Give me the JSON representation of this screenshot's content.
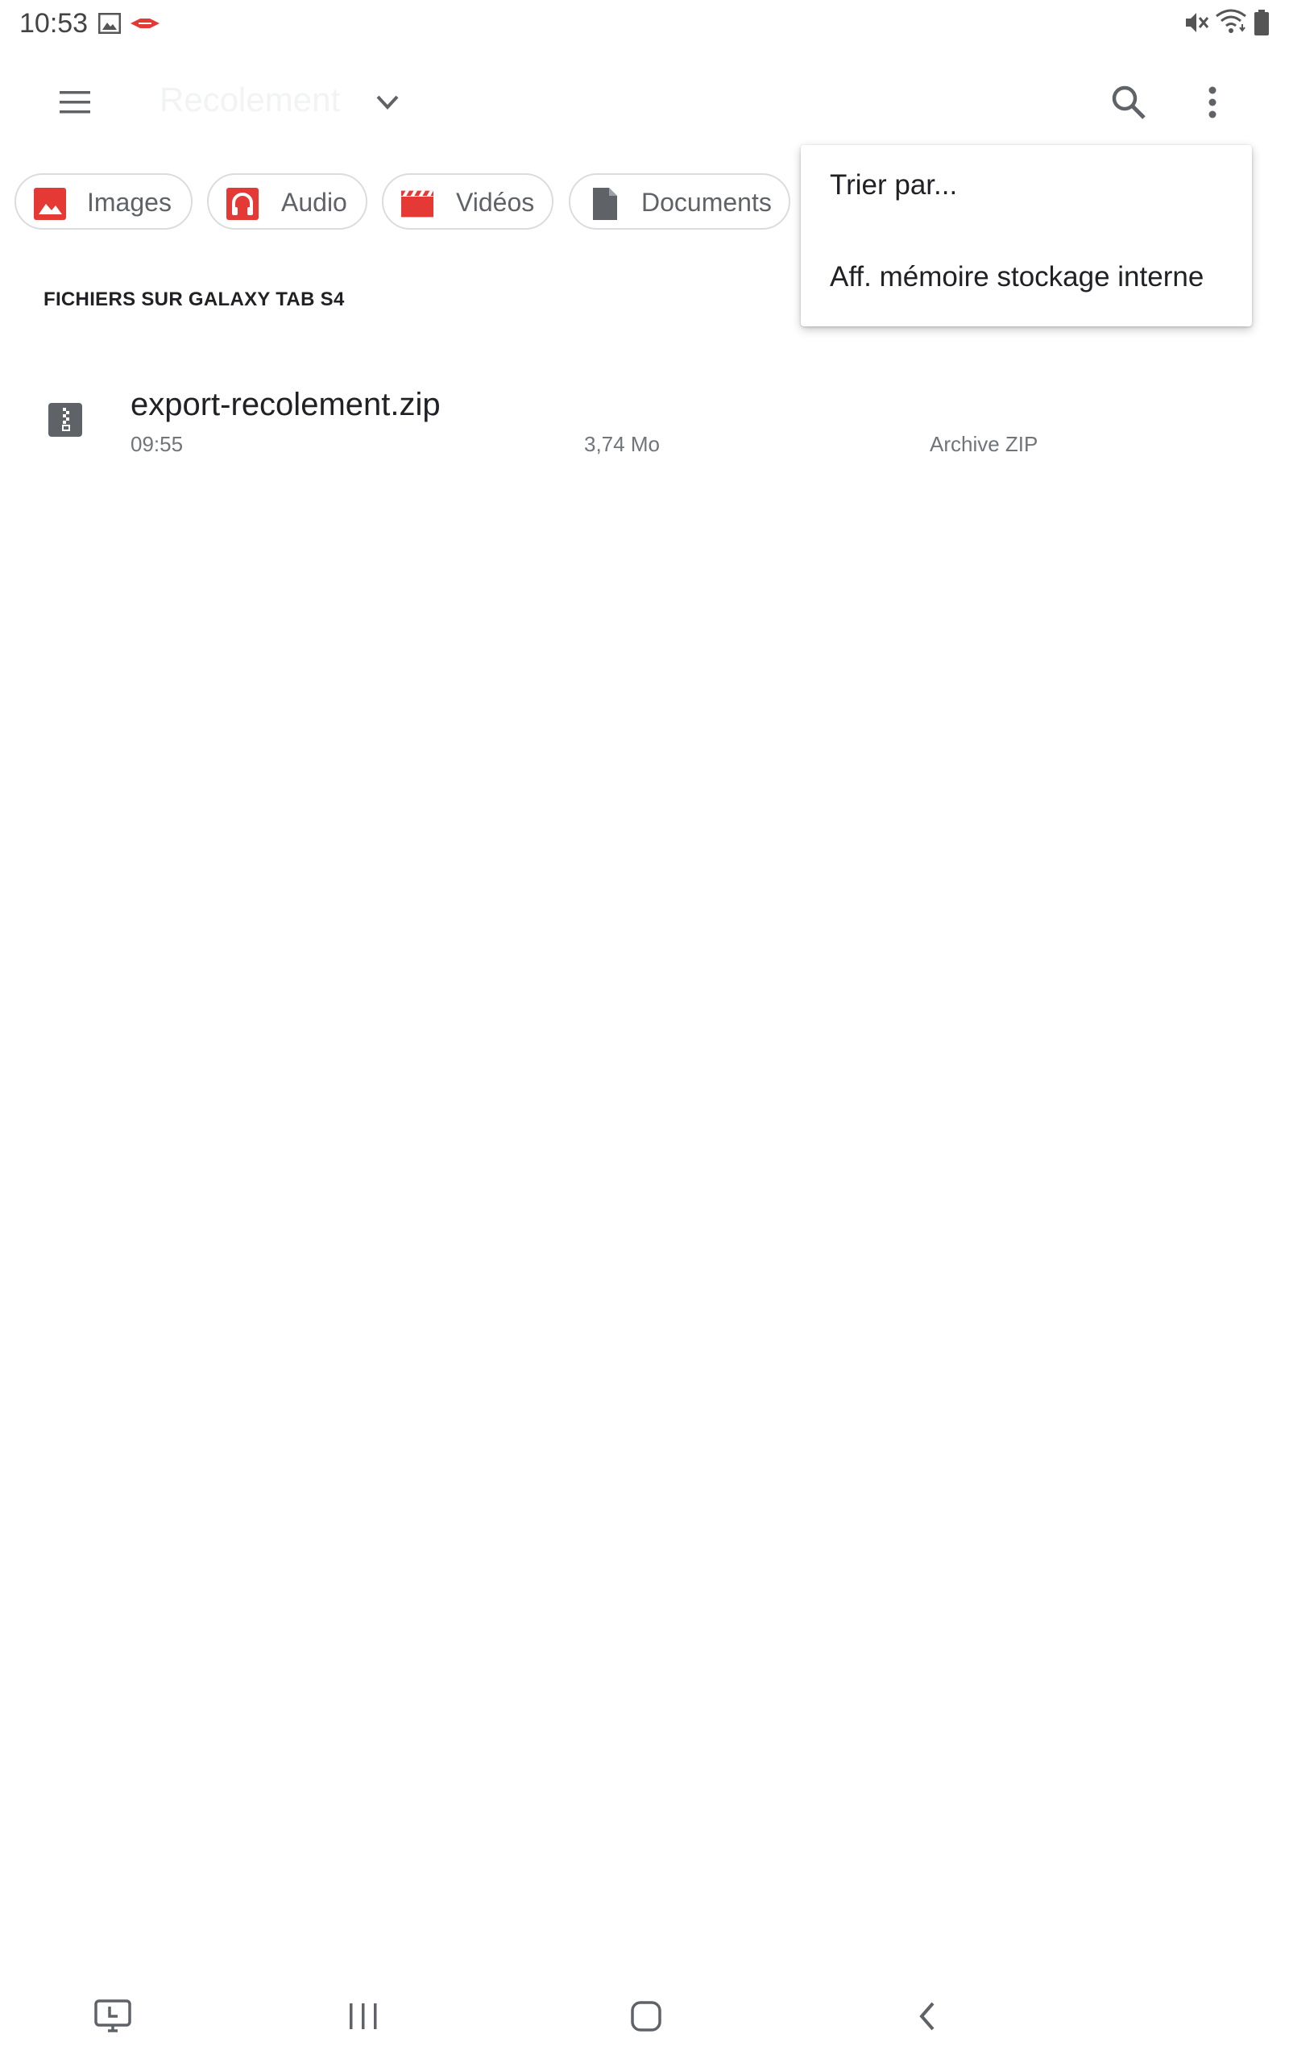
{
  "status_bar": {
    "time": "10:53"
  },
  "toolbar": {
    "title": "Recolement"
  },
  "chips": [
    {
      "label": "Images",
      "icon": "image-icon"
    },
    {
      "label": "Audio",
      "icon": "headphones-icon"
    },
    {
      "label": "Vidéos",
      "icon": "clapperboard-icon"
    },
    {
      "label": "Documents",
      "icon": "document-icon"
    }
  ],
  "section": {
    "header": "FICHIERS SUR GALAXY TAB S4"
  },
  "files": [
    {
      "name": "export-recolement.zip",
      "time": "09:55",
      "size": "3,74 Mo",
      "type": "Archive ZIP",
      "icon": "zip-file-icon"
    }
  ],
  "overflow_menu": {
    "items": [
      {
        "label": "Trier par..."
      },
      {
        "label": "Aff. mémoire stockage interne"
      }
    ]
  },
  "colors": {
    "accent_red": "#e53935",
    "text_primary": "#202124",
    "text_secondary": "#70757a",
    "chip_border": "#dadce0",
    "icon_gray": "#5f6368"
  }
}
